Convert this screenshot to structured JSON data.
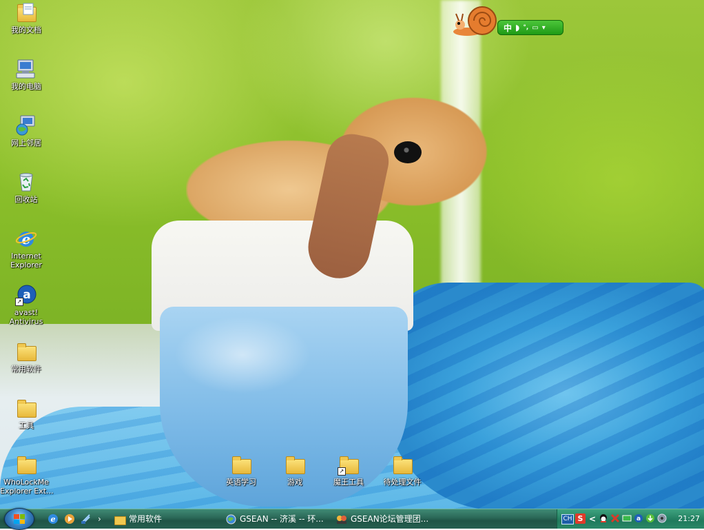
{
  "desktop_icons": [
    {
      "label": "我的文档",
      "icon": "my-documents-icon"
    },
    {
      "label": "我的电脑",
      "icon": "my-computer-icon"
    },
    {
      "label": "网上邻居",
      "icon": "network-places-icon"
    },
    {
      "label": "回收站",
      "icon": "recycle-bin-icon"
    },
    {
      "label_line1": "Internet",
      "label_line2": "Explorer",
      "icon": "internet-explorer-icon"
    },
    {
      "label_line1": "avast!",
      "label_line2": "Antivirus",
      "icon": "avast-icon"
    },
    {
      "label": "常用软件",
      "icon": "folder-icon"
    },
    {
      "label": "工具",
      "icon": "folder-icon"
    },
    {
      "label_line1": "WhoLockMe",
      "label_line2": "Explorer Ext...",
      "icon": "folder-icon"
    }
  ],
  "bottom_folders": [
    {
      "label": "英语学习"
    },
    {
      "label": "游戏"
    },
    {
      "label": "魔王工具"
    },
    {
      "label": "待处理文件"
    }
  ],
  "language_bar": {
    "mode": "中"
  },
  "taskbar": {
    "quick_launch_more": "›",
    "tasks": [
      {
        "label": "常用软件",
        "icon": "folder-icon"
      },
      {
        "label": "GSEAN -- 济溪 -- 环...",
        "icon": "globe-icon"
      },
      {
        "label": "GSEAN论坛管理团...",
        "icon": "qq-chat-icon"
      }
    ],
    "tray": {
      "lang": "CH",
      "expand": "<",
      "clock": "21:27"
    }
  },
  "colors": {
    "taskbar": "#2d6b5a",
    "tray": "#1f7a5c",
    "langbar": "#1f9a16"
  }
}
